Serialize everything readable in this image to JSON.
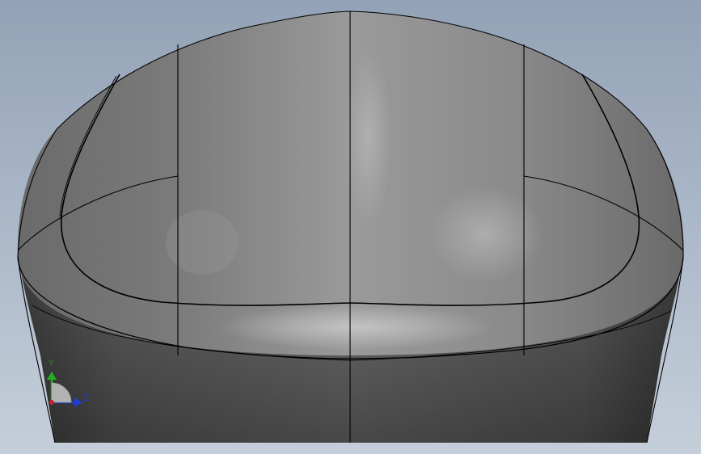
{
  "triad": {
    "y_label": "Y",
    "z_label": "Z",
    "y_color": "#22b022",
    "z_color": "#1f3fd0",
    "x_color": "#cc2222"
  },
  "colors": {
    "background_top": "#93a2b6",
    "background_bottom": "#c5cfda",
    "model_shade": "#7a7a7a",
    "edge_line": "#000000"
  }
}
